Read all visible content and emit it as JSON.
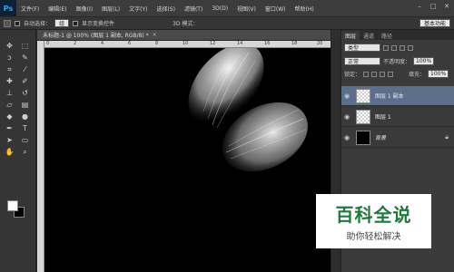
{
  "app": {
    "logo": "Ps"
  },
  "menu": [
    "文件(F)",
    "编辑(E)",
    "图像(I)",
    "图层(L)",
    "文字(Y)",
    "选择(S)",
    "滤镜(T)",
    "3D(D)",
    "视图(V)",
    "窗口(W)",
    "帮助(H)"
  ],
  "window_controls": [
    "–",
    "□",
    "✕"
  ],
  "options": {
    "auto_select_label": "自动选择：",
    "auto_select_value": "组",
    "show_transform_label": "显示变换控件",
    "mode_3d_label": "3D 模式：",
    "workspace": "基本功能"
  },
  "document": {
    "tab_label": "未标题-1 @ 100% (图层 1 副本, RGB/8) *",
    "close": "×",
    "ruler_ticks": [
      "0",
      "2",
      "4",
      "6",
      "8",
      "10",
      "12",
      "14",
      "16",
      "18",
      "20"
    ]
  },
  "colors": {
    "foreground": "#ffffff",
    "background": "#000000"
  },
  "panel": {
    "tabs": [
      "图层",
      "通道",
      "路径"
    ],
    "filter_label": "类型",
    "blend_mode": "正常",
    "opacity_label": "不透明度：",
    "opacity_value": "100%",
    "lock_label": "锁定：",
    "fill_label": "填充：",
    "fill_value": "100%",
    "layers": [
      {
        "name": "图层 1 副本",
        "selected": true,
        "thumb": "checker"
      },
      {
        "name": "图层 1",
        "selected": false,
        "thumb": "checker"
      },
      {
        "name": "背景",
        "selected": false,
        "thumb": "black"
      }
    ]
  },
  "watermark": {
    "title": "百科全说",
    "subtitle": "助你轻松解决"
  }
}
